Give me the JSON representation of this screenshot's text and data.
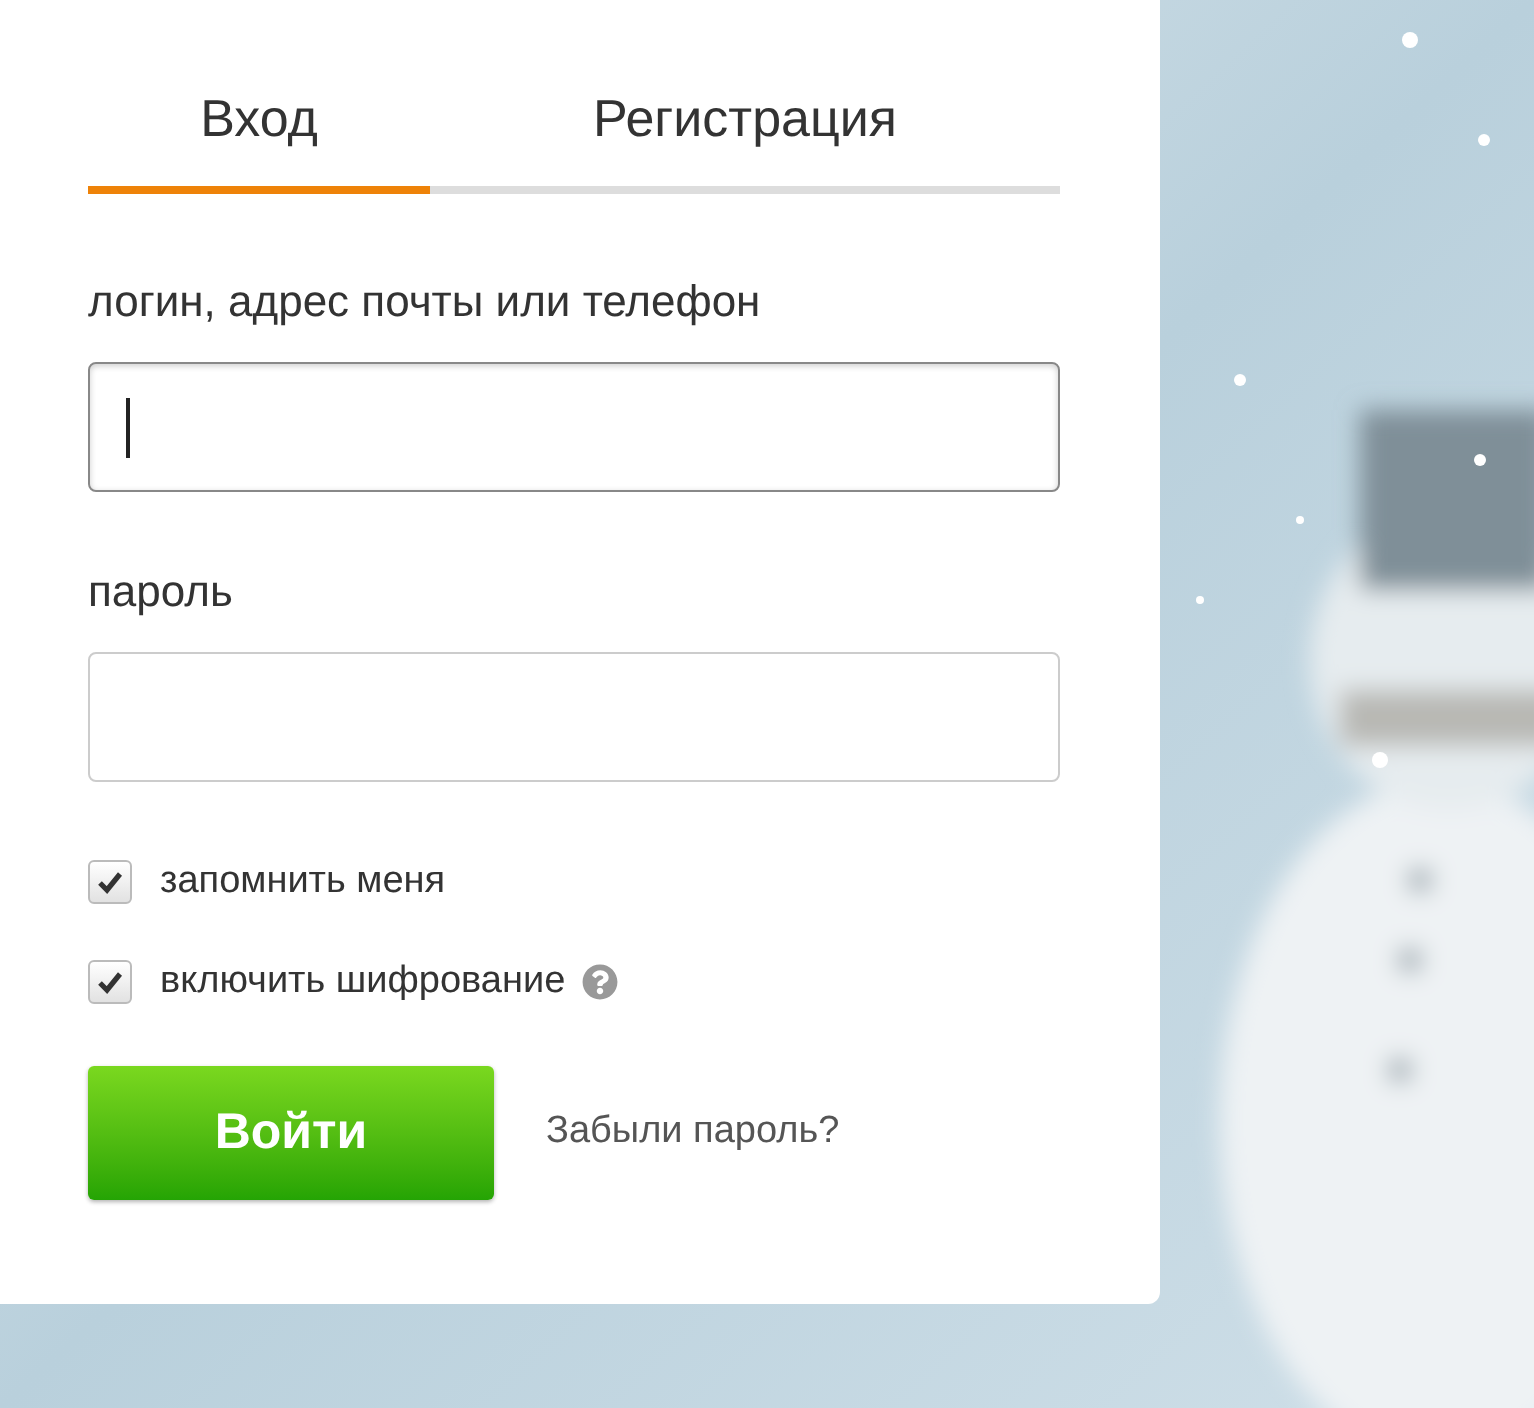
{
  "tabs": [
    {
      "label": "Вход",
      "selected": true
    },
    {
      "label": "Регистрация",
      "selected": false
    }
  ],
  "fields": [
    {
      "label": "логин, адрес почты или телефон",
      "focused": true
    },
    {
      "label": "пароль",
      "focused": false
    }
  ],
  "checkboxes": [
    {
      "label": "запомнить меня",
      "checked": true,
      "help": false
    },
    {
      "label": "включить шифрование",
      "checked": true,
      "help": true
    }
  ],
  "submit": "Войти",
  "forgot_link": "Забыли пароль?"
}
